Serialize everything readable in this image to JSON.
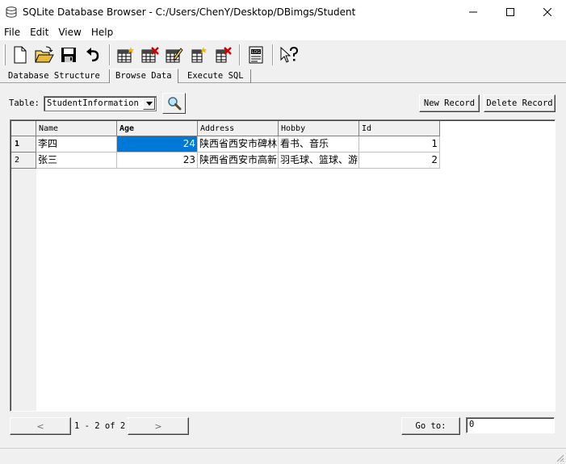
{
  "window": {
    "title": "SQLite Database Browser - C:/Users/ChenY/Desktop/DBimgs/Student",
    "icons": {
      "app": "database-icon",
      "minimize": "minimize-icon",
      "maximize": "maximize-icon",
      "close": "close-icon"
    }
  },
  "menu": {
    "items": [
      "File",
      "Edit",
      "View",
      "Help"
    ]
  },
  "toolbar": {
    "buttons": [
      "new-database-icon",
      "open-database-icon",
      "save-icon",
      "undo-icon",
      "create-table-icon",
      "delete-table-icon",
      "modify-table-icon",
      "create-index-icon",
      "delete-index-icon",
      "log-window-icon",
      "whats-this-icon"
    ]
  },
  "tabs": {
    "items": [
      "Database Structure",
      "Browse Data",
      "Execute SQL"
    ],
    "active_index": 1
  },
  "browse": {
    "table_label": "Table:",
    "table_selected": "StudentInformation",
    "new_record_label": "New Record",
    "delete_record_label": "Delete Record",
    "columns": [
      "Name",
      "Age",
      "Address",
      "Hobby",
      "Id"
    ],
    "sorted_column": "Age",
    "rows": [
      {
        "row_num": "1",
        "Name": "李四",
        "Age": "24",
        "Address": "陕西省西安市碑林",
        "Hobby": "看书、音乐",
        "Id": "1"
      },
      {
        "row_num": "2",
        "Name": "张三",
        "Age": "23",
        "Address": "陕西省西安市高新",
        "Hobby": "羽毛球、篮球、游",
        "Id": "2"
      }
    ],
    "selected_cell": {
      "row": 0,
      "column": "Age"
    }
  },
  "navigation": {
    "prev_label": "<",
    "next_label": ">",
    "page_info": "1 - 2 of 2",
    "goto_label": "Go to:",
    "goto_value": "0"
  }
}
